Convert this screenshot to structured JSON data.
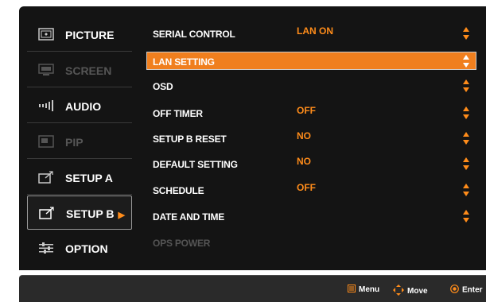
{
  "sidebar": {
    "items": [
      {
        "label": "PICTURE",
        "icon": "picture-icon",
        "enabled": true,
        "selected": false
      },
      {
        "label": "SCREEN",
        "icon": "screen-icon",
        "enabled": false,
        "selected": false
      },
      {
        "label": "AUDIO",
        "icon": "audio-icon",
        "enabled": true,
        "selected": false
      },
      {
        "label": "PIP",
        "icon": "pip-icon",
        "enabled": false,
        "selected": false
      },
      {
        "label": "SETUP A",
        "icon": "setup-icon",
        "enabled": true,
        "selected": false
      },
      {
        "label": "SETUP B",
        "icon": "setup-icon",
        "enabled": true,
        "selected": true
      },
      {
        "label": "OPTION",
        "icon": "option-icon",
        "enabled": true,
        "selected": false
      }
    ],
    "selected_arrow": "▶"
  },
  "menu": {
    "items": [
      {
        "label": "SERIAL CONTROL",
        "value": "LAN ON",
        "enabled": true,
        "highlighted": false
      },
      {
        "label": "LAN SETTING",
        "value": "",
        "enabled": true,
        "highlighted": true
      },
      {
        "label": "OSD",
        "value": "",
        "enabled": true,
        "highlighted": false
      },
      {
        "label": "OFF TIMER",
        "value": "OFF",
        "enabled": true,
        "highlighted": false
      },
      {
        "label": "SETUP B RESET",
        "value": "NO",
        "enabled": true,
        "highlighted": false
      },
      {
        "label": "DEFAULT SETTING",
        "value": "NO",
        "enabled": true,
        "highlighted": false
      },
      {
        "label": "SCHEDULE",
        "value": "OFF",
        "enabled": true,
        "highlighted": false
      },
      {
        "label": "DATE AND TIME",
        "value": "",
        "enabled": true,
        "highlighted": false
      },
      {
        "label": "OPS POWER",
        "value": "",
        "enabled": false,
        "highlighted": false
      }
    ]
  },
  "footer": {
    "menu_label": "Menu",
    "move_label": "Move",
    "enter_label": "Enter"
  },
  "colors": {
    "accent": "#f07f1e",
    "value": "#ff8c1a",
    "background": "#141414",
    "disabled": "#555555"
  }
}
